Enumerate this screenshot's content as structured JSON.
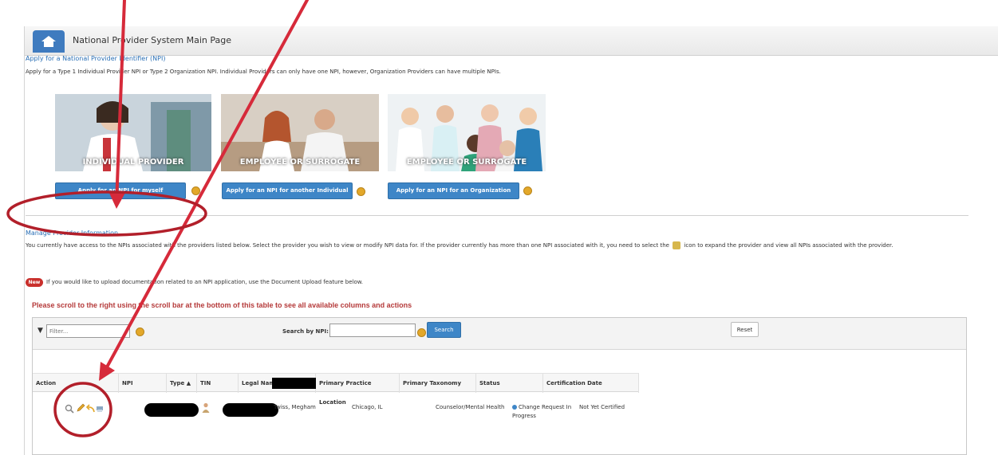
{
  "header": {
    "title": "National Provider System Main Page",
    "home_icon": "home-icon"
  },
  "apply": {
    "heading": "Apply for a National Provider Identifier (NPI)",
    "description": "Apply for a Type 1 Individual Provider NPI or Type 2 Organization NPI. Individual Providers can only have one NPI, however, Organization Providers can have multiple NPIs.",
    "cards": [
      {
        "caption": "INDIVIDUAL PROVIDER",
        "button": "Apply for an NPI for myself"
      },
      {
        "caption": "EMPLOYEE OR SURROGATE",
        "button": "Apply for an NPI for another Individual"
      },
      {
        "caption": "EMPLOYEE OR SURROGATE",
        "button": "Apply for an NPI for an Organization"
      }
    ]
  },
  "manage": {
    "heading": "Manage Provider Information",
    "description_part1": "You currently have access to the NPIs associated with the providers listed below. Select the provider you wish to view or modify NPI data for. If the provider currently has more than one NPI associated with it, you need to select the",
    "description_part2": "icon to expand the provider and view all NPIs associated with the provider.",
    "new_badge": "New",
    "upload_text": "If you would like to upload documentation related to an NPI application, use the Document Upload feature below.",
    "scroll_notice": "Please scroll to the right using the scroll bar at the bottom of this table to see all available columns and actions"
  },
  "table": {
    "filter_placeholder": "Filter...",
    "search_label": "Search by NPI:",
    "search_button": "Search",
    "reset_button": "Reset",
    "columns": [
      "Action",
      "NPI",
      "Type ▲",
      "TIN",
      "Legal Name",
      "Primary Practice Location",
      "Primary Taxonomy",
      "Status",
      "Certification Date"
    ],
    "rows": [
      {
        "name": "Twiss, Megham",
        "location": "Chicago, IL",
        "taxonomy": "Counselor/Mental Health",
        "status_line1": "Change Request In",
        "status_line2": "Progress",
        "certification": "Not Yet Certified"
      }
    ]
  },
  "colors": {
    "accent_blue": "#3e86c7",
    "link_blue": "#2a6fb5",
    "notice_red": "#b53a3a",
    "annotation_red": "#d62a3a",
    "info_orange": "#e3a82a"
  }
}
